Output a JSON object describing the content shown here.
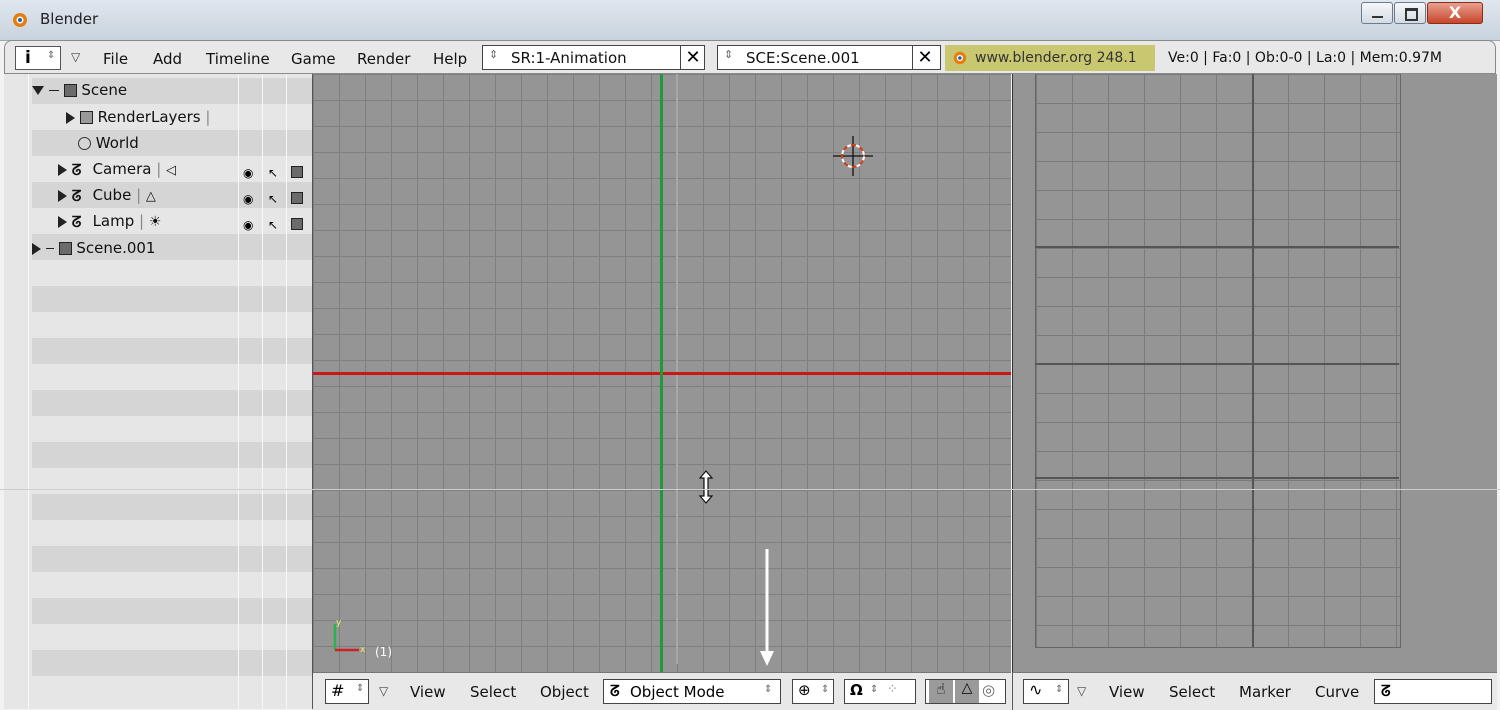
{
  "window": {
    "title": "Blender"
  },
  "header": {
    "menus": [
      "File",
      "Add",
      "Timeline",
      "Game",
      "Render",
      "Help"
    ],
    "screen_field": "SR:1-Animation",
    "scene_field": "SCE:Scene.001",
    "close_glyph": "✕",
    "link": "www.blender.org 248.1",
    "stats": "Ve:0 | Fa:0 | Ob:0-0 | La:0  | Mem:0.97M"
  },
  "outliner": {
    "items": [
      {
        "label": "Scene"
      },
      {
        "label": "RenderLayers"
      },
      {
        "label": "World"
      },
      {
        "label": "Camera"
      },
      {
        "label": "Cube"
      },
      {
        "label": "Lamp"
      },
      {
        "label": "Scene.001"
      }
    ]
  },
  "viewport": {
    "frame": "(1)",
    "axis_x": "x",
    "axis_y": "y",
    "menus": [
      "View",
      "Select",
      "Object"
    ],
    "mode": "Object Mode"
  },
  "ipo": {
    "menus": [
      "View",
      "Select",
      "Marker",
      "Curve"
    ]
  },
  "colors": {
    "x_axis": "#c81818",
    "y_axis": "#1e9a3a",
    "link_bg": "#c9c870"
  }
}
